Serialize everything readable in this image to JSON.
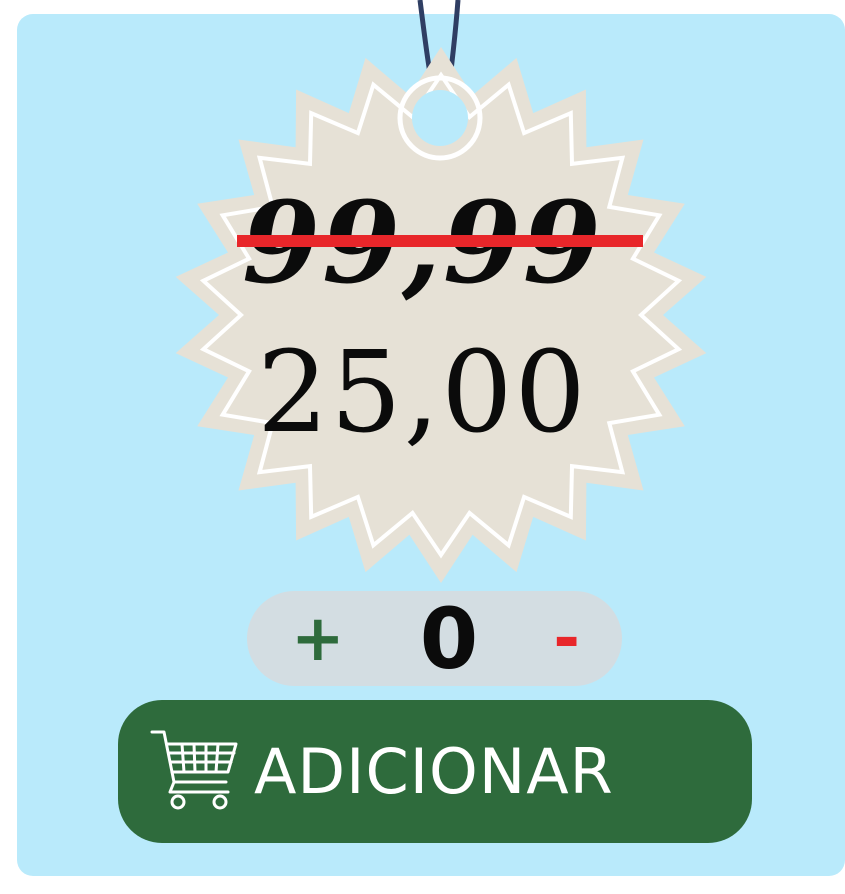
{
  "tag": {
    "old_price": "99,99",
    "new_price_main": "25",
    "new_price_cents": ",00"
  },
  "stepper": {
    "plus_label": "+",
    "quantity": "0",
    "minus_label": "-"
  },
  "add_button": {
    "label": "ADICIONAR",
    "icon": "shopping-cart-icon"
  },
  "colors": {
    "background": "#b9eafb",
    "tag": "#e6e1d6",
    "strike": "#e8262a",
    "primary_green": "#2e6b3c",
    "stepper_bg": "#d3dde2"
  }
}
